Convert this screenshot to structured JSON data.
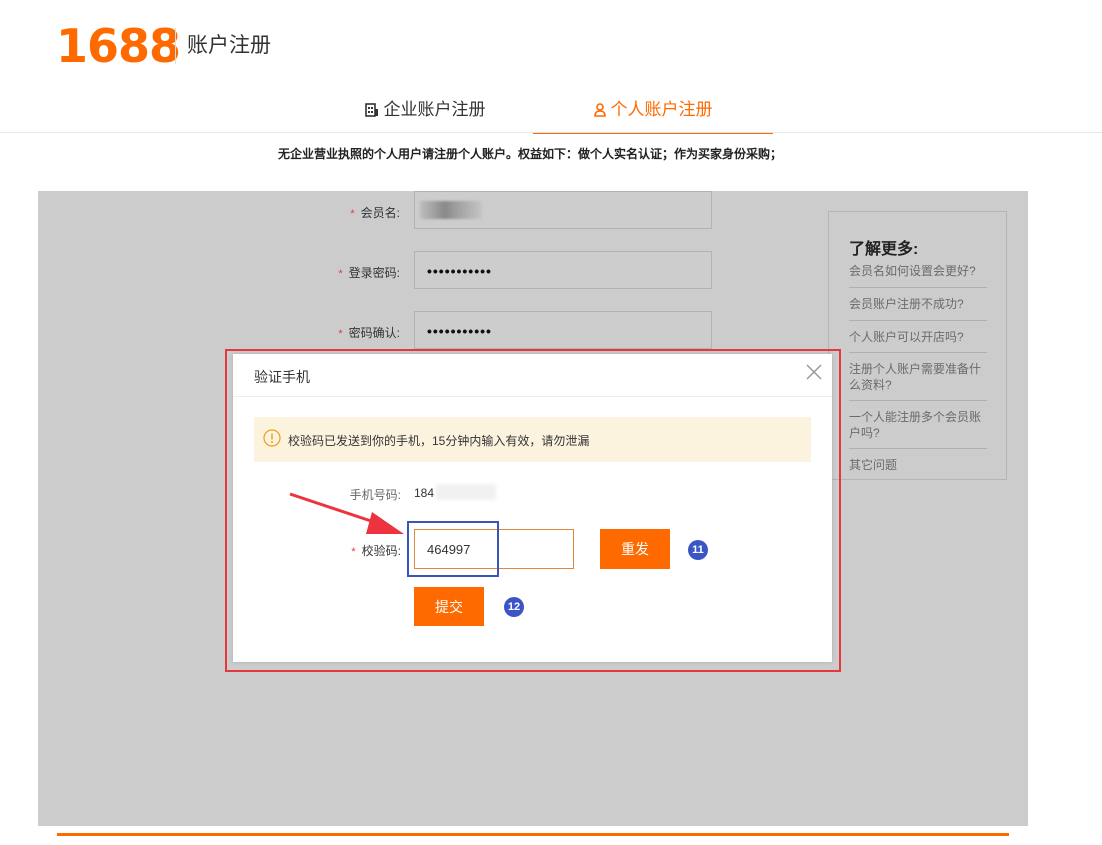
{
  "header": {
    "logo": "1688",
    "title": "账户注册"
  },
  "tabs": [
    {
      "label": "企业账户注册",
      "icon": "building-icon",
      "active": false
    },
    {
      "label": "个人账户注册",
      "icon": "user-icon",
      "active": true
    }
  ],
  "notice": "无企业营业执照的个人用户请注册个人账户。权益如下：做个人实名认证；作为买家身份采购；",
  "form": {
    "member_name_label": "会员名:",
    "password_label": "登录密码:",
    "password_value": "•••••••••••",
    "confirm_label": "密码确认:",
    "confirm_value": "•••••••••••",
    "required_mark": "*"
  },
  "sidebar": {
    "title": "了解更多:",
    "links": [
      "会员名如何设置会更好?",
      "会员账户注册不成功?",
      "个人账户可以开店吗?",
      "注册个人账户需要准备什么资料?",
      "一个人能注册多个会员账户吗?",
      "其它问题"
    ]
  },
  "modal": {
    "title": "验证手机",
    "info": "校验码已发送到你的手机，15分钟内输入有效，请勿泄漏",
    "phone_label": "手机号码:",
    "phone_value": "184",
    "code_label": "校验码:",
    "code_value": "464997",
    "resend_label": "重发",
    "submit_label": "提交"
  },
  "annotations": {
    "badge_resend": "11",
    "badge_submit": "12"
  },
  "colors": {
    "brand": "#ff6a00",
    "overlay": "#cccccc",
    "highlight_red": "#e4393c",
    "highlight_blue": "#3a54b8",
    "badge": "#3b55c7"
  }
}
